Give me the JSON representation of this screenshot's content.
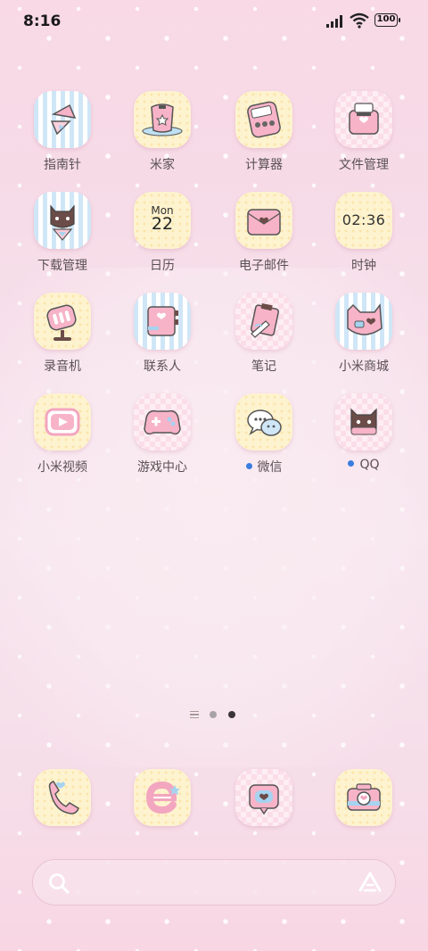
{
  "status_bar": {
    "time": "8:16",
    "battery": "100"
  },
  "apps": [
    {
      "label": "指南针",
      "icon": "compass-icon"
    },
    {
      "label": "米家",
      "icon": "mijia-icon"
    },
    {
      "label": "计算器",
      "icon": "calculator-icon"
    },
    {
      "label": "文件管理",
      "icon": "file-manager-icon"
    },
    {
      "label": "下载管理",
      "icon": "download-manager-icon"
    },
    {
      "label": "日历",
      "icon": "calendar-icon",
      "month": "Mon",
      "day": "22"
    },
    {
      "label": "电子邮件",
      "icon": "email-icon"
    },
    {
      "label": "时钟",
      "icon": "clock-icon",
      "time": "02:36"
    },
    {
      "label": "录音机",
      "icon": "recorder-icon"
    },
    {
      "label": "联系人",
      "icon": "contacts-icon"
    },
    {
      "label": "笔记",
      "icon": "notes-icon"
    },
    {
      "label": "小米商城",
      "icon": "mi-store-icon"
    },
    {
      "label": "小米视频",
      "icon": "mi-video-icon"
    },
    {
      "label": "游戏中心",
      "icon": "game-center-icon"
    },
    {
      "label": "微信",
      "icon": "wechat-icon",
      "badge_dot": true
    },
    {
      "label": "QQ",
      "icon": "qq-icon",
      "badge_dot": true
    }
  ],
  "dock": [
    {
      "icon": "phone-icon"
    },
    {
      "icon": "browser-icon"
    },
    {
      "icon": "messages-icon"
    },
    {
      "icon": "camera-icon"
    }
  ],
  "pager": {
    "pages": 2,
    "current": 2
  },
  "colors": {
    "accent_pink": "#f3a6bf",
    "badge_blue": "#3a7de0",
    "label": "#5a5053"
  }
}
